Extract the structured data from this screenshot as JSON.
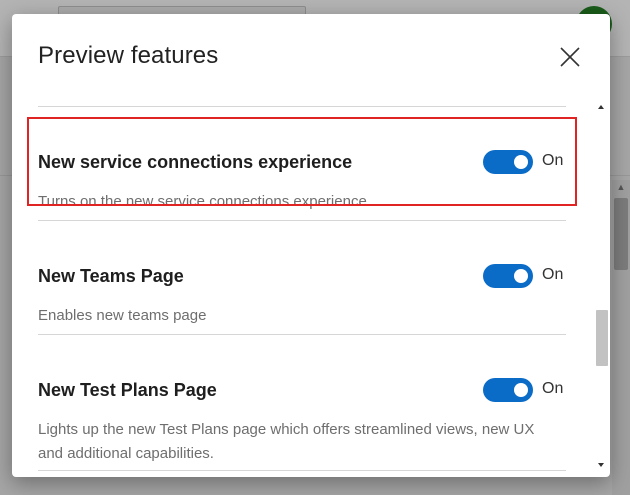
{
  "dialog": {
    "title": "Preview features",
    "close_icon": "close-icon"
  },
  "features": [
    {
      "title": "New service connections experience",
      "description": "Turns on the new service connections experience.",
      "state": "On",
      "enabled": true,
      "highlighted": true
    },
    {
      "title": "New Teams Page",
      "description": "Enables new teams page",
      "state": "On",
      "enabled": true,
      "highlighted": false
    },
    {
      "title": "New Test Plans Page",
      "description": "Lights up the new Test Plans page which offers streamlined views, new UX and additional capabilities.",
      "state": "On",
      "enabled": true,
      "highlighted": false
    }
  ],
  "colors": {
    "toggle_on": "#0b6cc8",
    "highlight_border": "#e02424",
    "avatar": "#1a5c1a"
  },
  "icons": {
    "scroll_up": "chevron-up-icon",
    "scroll_down": "chevron-down-icon"
  }
}
